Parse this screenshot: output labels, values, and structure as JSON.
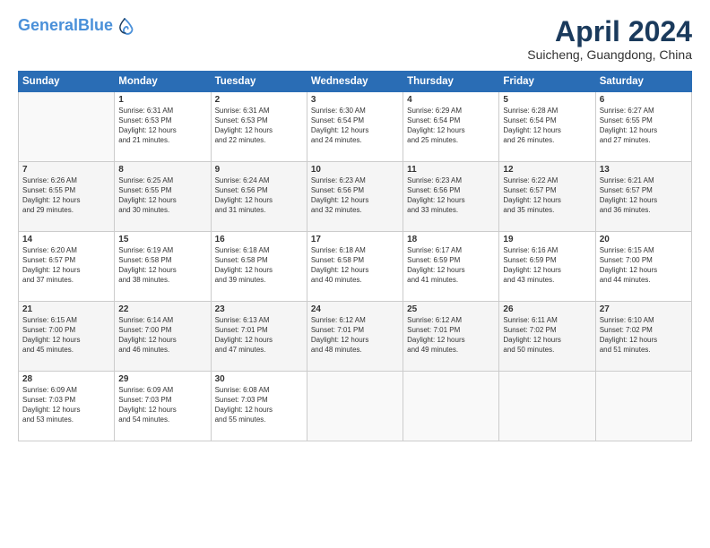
{
  "header": {
    "logo_line1": "General",
    "logo_line2": "Blue",
    "title": "April 2024",
    "location": "Suicheng, Guangdong, China"
  },
  "columns": [
    "Sunday",
    "Monday",
    "Tuesday",
    "Wednesday",
    "Thursday",
    "Friday",
    "Saturday"
  ],
  "weeks": [
    [
      {
        "day": "",
        "info": ""
      },
      {
        "day": "1",
        "info": "Sunrise: 6:31 AM\nSunset: 6:53 PM\nDaylight: 12 hours\nand 21 minutes."
      },
      {
        "day": "2",
        "info": "Sunrise: 6:31 AM\nSunset: 6:53 PM\nDaylight: 12 hours\nand 22 minutes."
      },
      {
        "day": "3",
        "info": "Sunrise: 6:30 AM\nSunset: 6:54 PM\nDaylight: 12 hours\nand 24 minutes."
      },
      {
        "day": "4",
        "info": "Sunrise: 6:29 AM\nSunset: 6:54 PM\nDaylight: 12 hours\nand 25 minutes."
      },
      {
        "day": "5",
        "info": "Sunrise: 6:28 AM\nSunset: 6:54 PM\nDaylight: 12 hours\nand 26 minutes."
      },
      {
        "day": "6",
        "info": "Sunrise: 6:27 AM\nSunset: 6:55 PM\nDaylight: 12 hours\nand 27 minutes."
      }
    ],
    [
      {
        "day": "7",
        "info": "Sunrise: 6:26 AM\nSunset: 6:55 PM\nDaylight: 12 hours\nand 29 minutes."
      },
      {
        "day": "8",
        "info": "Sunrise: 6:25 AM\nSunset: 6:55 PM\nDaylight: 12 hours\nand 30 minutes."
      },
      {
        "day": "9",
        "info": "Sunrise: 6:24 AM\nSunset: 6:56 PM\nDaylight: 12 hours\nand 31 minutes."
      },
      {
        "day": "10",
        "info": "Sunrise: 6:23 AM\nSunset: 6:56 PM\nDaylight: 12 hours\nand 32 minutes."
      },
      {
        "day": "11",
        "info": "Sunrise: 6:23 AM\nSunset: 6:56 PM\nDaylight: 12 hours\nand 33 minutes."
      },
      {
        "day": "12",
        "info": "Sunrise: 6:22 AM\nSunset: 6:57 PM\nDaylight: 12 hours\nand 35 minutes."
      },
      {
        "day": "13",
        "info": "Sunrise: 6:21 AM\nSunset: 6:57 PM\nDaylight: 12 hours\nand 36 minutes."
      }
    ],
    [
      {
        "day": "14",
        "info": "Sunrise: 6:20 AM\nSunset: 6:57 PM\nDaylight: 12 hours\nand 37 minutes."
      },
      {
        "day": "15",
        "info": "Sunrise: 6:19 AM\nSunset: 6:58 PM\nDaylight: 12 hours\nand 38 minutes."
      },
      {
        "day": "16",
        "info": "Sunrise: 6:18 AM\nSunset: 6:58 PM\nDaylight: 12 hours\nand 39 minutes."
      },
      {
        "day": "17",
        "info": "Sunrise: 6:18 AM\nSunset: 6:58 PM\nDaylight: 12 hours\nand 40 minutes."
      },
      {
        "day": "18",
        "info": "Sunrise: 6:17 AM\nSunset: 6:59 PM\nDaylight: 12 hours\nand 41 minutes."
      },
      {
        "day": "19",
        "info": "Sunrise: 6:16 AM\nSunset: 6:59 PM\nDaylight: 12 hours\nand 43 minutes."
      },
      {
        "day": "20",
        "info": "Sunrise: 6:15 AM\nSunset: 7:00 PM\nDaylight: 12 hours\nand 44 minutes."
      }
    ],
    [
      {
        "day": "21",
        "info": "Sunrise: 6:15 AM\nSunset: 7:00 PM\nDaylight: 12 hours\nand 45 minutes."
      },
      {
        "day": "22",
        "info": "Sunrise: 6:14 AM\nSunset: 7:00 PM\nDaylight: 12 hours\nand 46 minutes."
      },
      {
        "day": "23",
        "info": "Sunrise: 6:13 AM\nSunset: 7:01 PM\nDaylight: 12 hours\nand 47 minutes."
      },
      {
        "day": "24",
        "info": "Sunrise: 6:12 AM\nSunset: 7:01 PM\nDaylight: 12 hours\nand 48 minutes."
      },
      {
        "day": "25",
        "info": "Sunrise: 6:12 AM\nSunset: 7:01 PM\nDaylight: 12 hours\nand 49 minutes."
      },
      {
        "day": "26",
        "info": "Sunrise: 6:11 AM\nSunset: 7:02 PM\nDaylight: 12 hours\nand 50 minutes."
      },
      {
        "day": "27",
        "info": "Sunrise: 6:10 AM\nSunset: 7:02 PM\nDaylight: 12 hours\nand 51 minutes."
      }
    ],
    [
      {
        "day": "28",
        "info": "Sunrise: 6:09 AM\nSunset: 7:03 PM\nDaylight: 12 hours\nand 53 minutes."
      },
      {
        "day": "29",
        "info": "Sunrise: 6:09 AM\nSunset: 7:03 PM\nDaylight: 12 hours\nand 54 minutes."
      },
      {
        "day": "30",
        "info": "Sunrise: 6:08 AM\nSunset: 7:03 PM\nDaylight: 12 hours\nand 55 minutes."
      },
      {
        "day": "",
        "info": ""
      },
      {
        "day": "",
        "info": ""
      },
      {
        "day": "",
        "info": ""
      },
      {
        "day": "",
        "info": ""
      }
    ]
  ]
}
